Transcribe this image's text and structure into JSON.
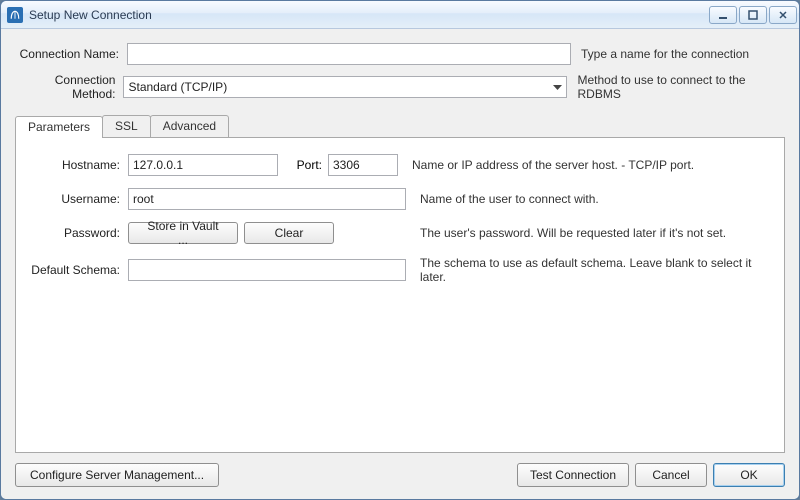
{
  "window": {
    "title": "Setup New Connection"
  },
  "form": {
    "conn_name": {
      "label": "Connection Name:",
      "value": "",
      "hint": "Type a name for the connection"
    },
    "conn_method": {
      "label": "Connection Method:",
      "value": "Standard (TCP/IP)",
      "hint": "Method to use to connect to the RDBMS"
    }
  },
  "tabs": {
    "parameters": "Parameters",
    "ssl": "SSL",
    "advanced": "Advanced"
  },
  "params": {
    "hostname": {
      "label": "Hostname:",
      "value": "127.0.0.1"
    },
    "port": {
      "label": "Port:",
      "value": "3306"
    },
    "host_hint": "Name or IP address of the server host. - TCP/IP port.",
    "username": {
      "label": "Username:",
      "value": "root",
      "hint": "Name of the user to connect with."
    },
    "password": {
      "label": "Password:",
      "store_btn": "Store in Vault ...",
      "clear_btn": "Clear",
      "hint": "The user's password. Will be requested later if it's not set."
    },
    "schema": {
      "label": "Default Schema:",
      "value": "",
      "hint": "The schema to use as default schema. Leave blank to select it later."
    }
  },
  "footer": {
    "configure": "Configure Server Management...",
    "test": "Test Connection",
    "cancel": "Cancel",
    "ok": "OK"
  }
}
